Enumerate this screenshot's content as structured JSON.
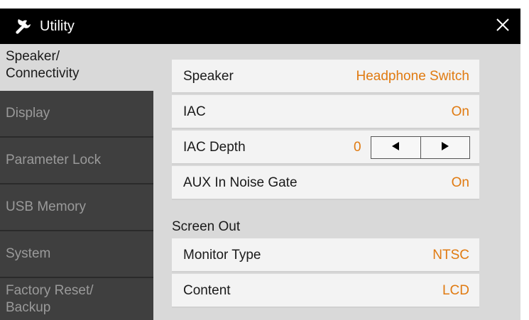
{
  "window": {
    "title": "Utility",
    "close_glyph": "✕"
  },
  "sidebar": {
    "tabs": [
      {
        "line1": "Speaker/",
        "line2": "Connectivity"
      },
      {
        "line1": "Display",
        "line2": ""
      },
      {
        "line1": "Parameter Lock",
        "line2": ""
      },
      {
        "line1": "USB Memory",
        "line2": ""
      },
      {
        "line1": "System",
        "line2": ""
      },
      {
        "line1": "Factory Reset/",
        "line2": "Backup"
      }
    ],
    "active_index": 0
  },
  "settings": {
    "speaker": {
      "label": "Speaker",
      "value": "Headphone Switch"
    },
    "iac": {
      "label": "IAC",
      "value": "On"
    },
    "iac_depth": {
      "label": "IAC Depth",
      "value": "0"
    },
    "aux_noise_gate": {
      "label": "AUX In Noise Gate",
      "value": "On"
    }
  },
  "screen_out": {
    "heading": "Screen Out",
    "monitor_type": {
      "label": "Monitor Type",
      "value": "NTSC"
    },
    "content": {
      "label": "Content",
      "value": "LCD"
    }
  },
  "icons": {
    "title": "wrench-icon",
    "close": "close-icon",
    "decrement": "triangle-left-icon",
    "increment": "triangle-right-icon"
  },
  "colors": {
    "titlebar": "#000000",
    "panel_bg": "#d9d9d9",
    "tab_bg": "#3f3f3f",
    "tab_text": "#9a9a9a",
    "row_bg": "#f3f3f3",
    "value_accent": "#e07a10"
  }
}
